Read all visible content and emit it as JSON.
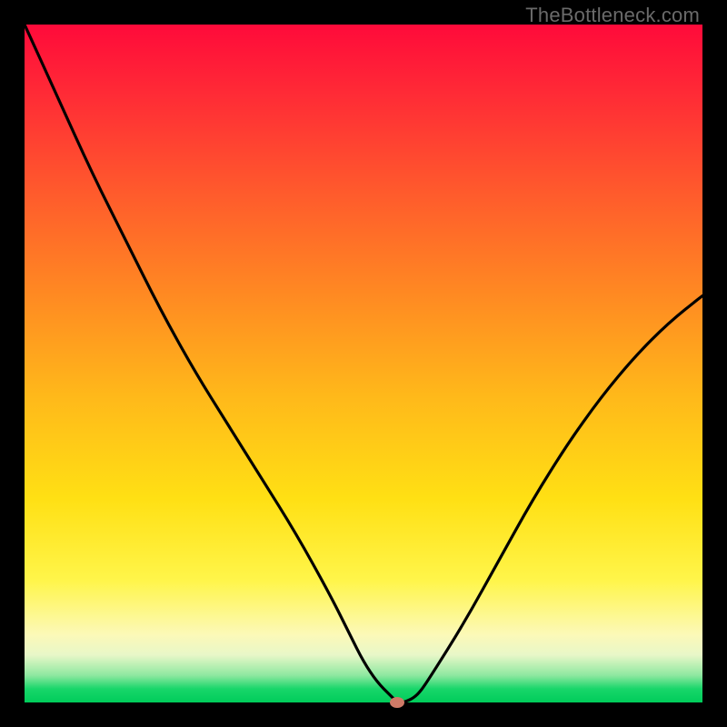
{
  "watermark": "TheBottleneck.com",
  "colors": {
    "frame": "#000000",
    "curve": "#000000",
    "dot": "#cf7a67",
    "gradient_top": "#ff0a3a",
    "gradient_bottom": "#00cc5a"
  },
  "chart_data": {
    "type": "line",
    "title": "",
    "xlabel": "",
    "ylabel": "",
    "xlim": [
      0,
      100
    ],
    "ylim": [
      0,
      100
    ],
    "note": "Axes have no visible tick labels; values are read as percent of plot width/height. Curve is a V-shaped bottleneck profile with minimum near x≈55.",
    "series": [
      {
        "name": "bottleneck-curve",
        "x": [
          0,
          5,
          10,
          15,
          20,
          25,
          30,
          35,
          40,
          45,
          48,
          50,
          52,
          54,
          55,
          56,
          58,
          60,
          65,
          70,
          75,
          80,
          85,
          90,
          95,
          100
        ],
        "y": [
          100,
          89,
          78,
          68,
          58,
          49,
          41,
          33,
          25,
          16,
          10,
          6,
          3,
          1,
          0,
          0,
          1,
          4,
          12,
          21,
          30,
          38,
          45,
          51,
          56,
          60
        ]
      }
    ],
    "marker": {
      "x": 55,
      "y": 0,
      "shape": "ellipse",
      "color": "#cf7a67"
    }
  }
}
